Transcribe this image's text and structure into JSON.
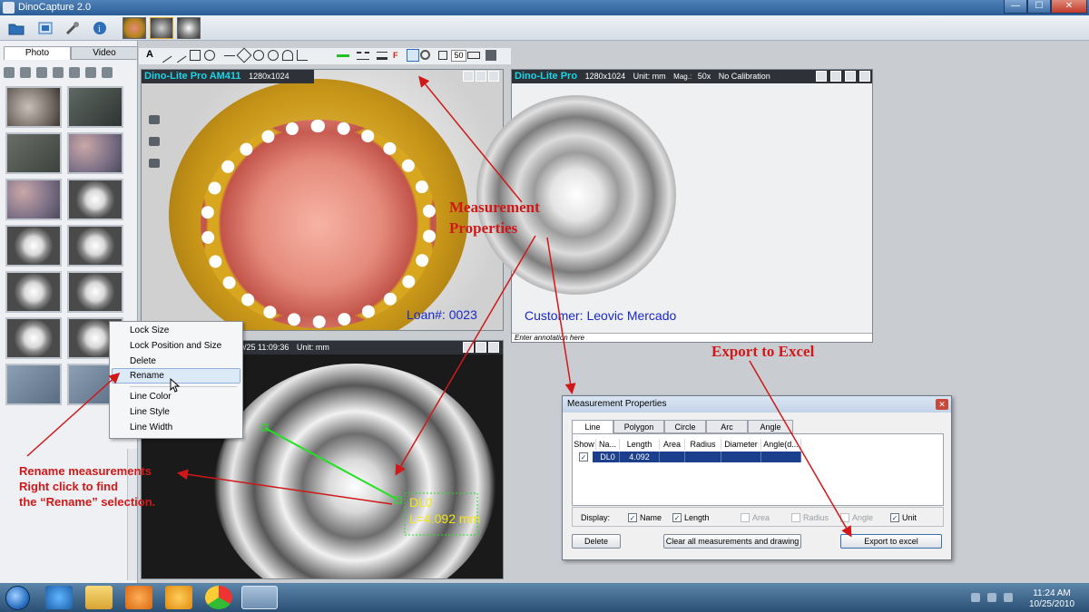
{
  "window": {
    "title": "DinoCapture 2.0",
    "buttons": {
      "minimize": "—",
      "maximize": "☐",
      "close": "✕"
    }
  },
  "left_panel": {
    "tabs": [
      "Photo",
      "Video"
    ],
    "active_tab": "Photo"
  },
  "toolbar": {
    "zoom_value": "50"
  },
  "viewer_top_left": {
    "brand": "Dino-Lite Pro AM411",
    "resolution": "1280x1024",
    "annotation": "Loan#: 0023"
  },
  "viewer_top_right": {
    "brand": "Dino-Lite Pro",
    "resolution": "1280x1024",
    "unit": "Unit: mm",
    "mag_label": "Mag.:",
    "mag_value": "50x",
    "calibration": "No Calibration",
    "annotation": "Customer: Leovic Mercado",
    "annotation_placeholder": "Enter annotation here"
  },
  "viewer_bottom": {
    "timestamp": "0/25 11:09:36",
    "unit": "Unit: mm",
    "measure_name": "DL0",
    "measure_value": "L=4.092 mm"
  },
  "context_menu": {
    "items": [
      "Lock Size",
      "Lock Position and Size",
      "Delete",
      "Rename",
      "Line Color",
      "Line Style",
      "Line Width"
    ],
    "highlighted": "Rename"
  },
  "measurement_dialog": {
    "title": "Measurement Properties",
    "close": "✕",
    "tabs": [
      "Line",
      "Polygon",
      "Circle",
      "Arc",
      "Angle"
    ],
    "active_tab": "Line",
    "columns": [
      "Show",
      "Na...",
      "Length",
      "Area",
      "Radius",
      "Diameter",
      "Angle(d..."
    ],
    "rows": [
      {
        "show": true,
        "name": "DL0",
        "length": "4.092",
        "area": "",
        "radius": "",
        "diameter": "",
        "angle": ""
      }
    ],
    "display_label": "Display:",
    "display_options": [
      {
        "label": "Name",
        "checked": true,
        "enabled": true
      },
      {
        "label": "Length",
        "checked": true,
        "enabled": true
      },
      {
        "label": "Area",
        "checked": false,
        "enabled": false
      },
      {
        "label": "Radius",
        "checked": false,
        "enabled": false
      },
      {
        "label": "Angle",
        "checked": false,
        "enabled": false
      },
      {
        "label": "Unit",
        "checked": true,
        "enabled": true
      }
    ],
    "buttons": {
      "delete": "Delete",
      "clear": "Clear all measurements and drawing",
      "export": "Export to excel"
    }
  },
  "callouts": {
    "measurement_properties_1": "Measurement",
    "measurement_properties_2": "Properties",
    "export_to_excel": "Export to Excel",
    "rename_1": "Rename measurements",
    "rename_2": "Right click to find",
    "rename_3": "the “Rename” selection."
  },
  "taskbar": {
    "time": "11:24 AM",
    "date": "10/25/2010"
  },
  "colors": {
    "callout_red": "#d01818",
    "annotation_blue": "#1a28c8",
    "measure_yellow": "#f4e419",
    "measure_green": "#22e022",
    "brand_cyan": "#19d6e8"
  }
}
